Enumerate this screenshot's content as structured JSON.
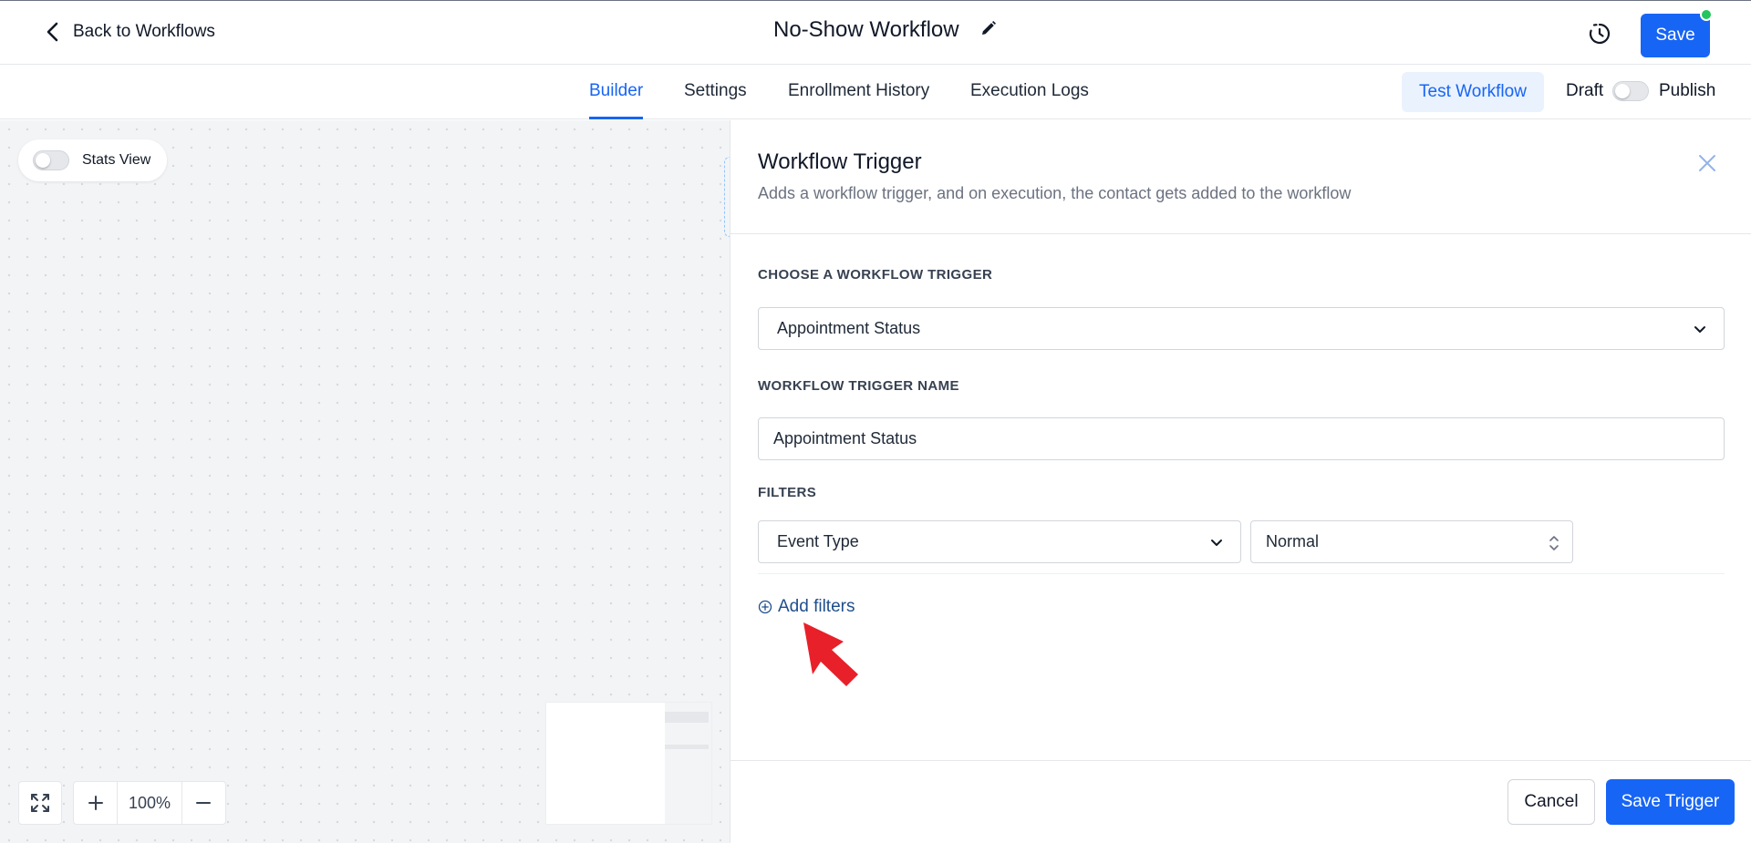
{
  "header": {
    "back_label": "Back to Workflows",
    "title": "No-Show Workflow",
    "save_label": "Save",
    "save_status_color": "#22c55e",
    "accent_color": "#1765f5"
  },
  "tabs": [
    {
      "label": "Builder",
      "active": true
    },
    {
      "label": "Settings",
      "active": false
    },
    {
      "label": "Enrollment History",
      "active": false
    },
    {
      "label": "Execution Logs",
      "active": false
    }
  ],
  "tabbar": {
    "test_label": "Test Workflow",
    "draft_label": "Draft",
    "publish_label": "Publish",
    "published": false
  },
  "canvas": {
    "stats_label": "Stats View",
    "stats_enabled": false,
    "zoom": "100%",
    "zoom_in_icon": "plus-icon",
    "zoom_out_icon": "minus-icon",
    "fit_icon": "fit-screen-icon"
  },
  "panel": {
    "title": "Workflow Trigger",
    "subtitle": "Adds a workflow trigger, and on execution, the contact gets added to the workflow",
    "choose_label": "CHOOSE A WORKFLOW TRIGGER",
    "trigger_value": "Appointment Status",
    "name_label": "WORKFLOW TRIGGER NAME",
    "name_value": "Appointment Status",
    "filters_label": "FILTERS",
    "filter_field": "Event Type",
    "filter_value": "Normal",
    "add_filters_label": "Add filters",
    "cancel_label": "Cancel",
    "save_trigger_label": "Save Trigger",
    "annotation_color": "#e8202a"
  }
}
